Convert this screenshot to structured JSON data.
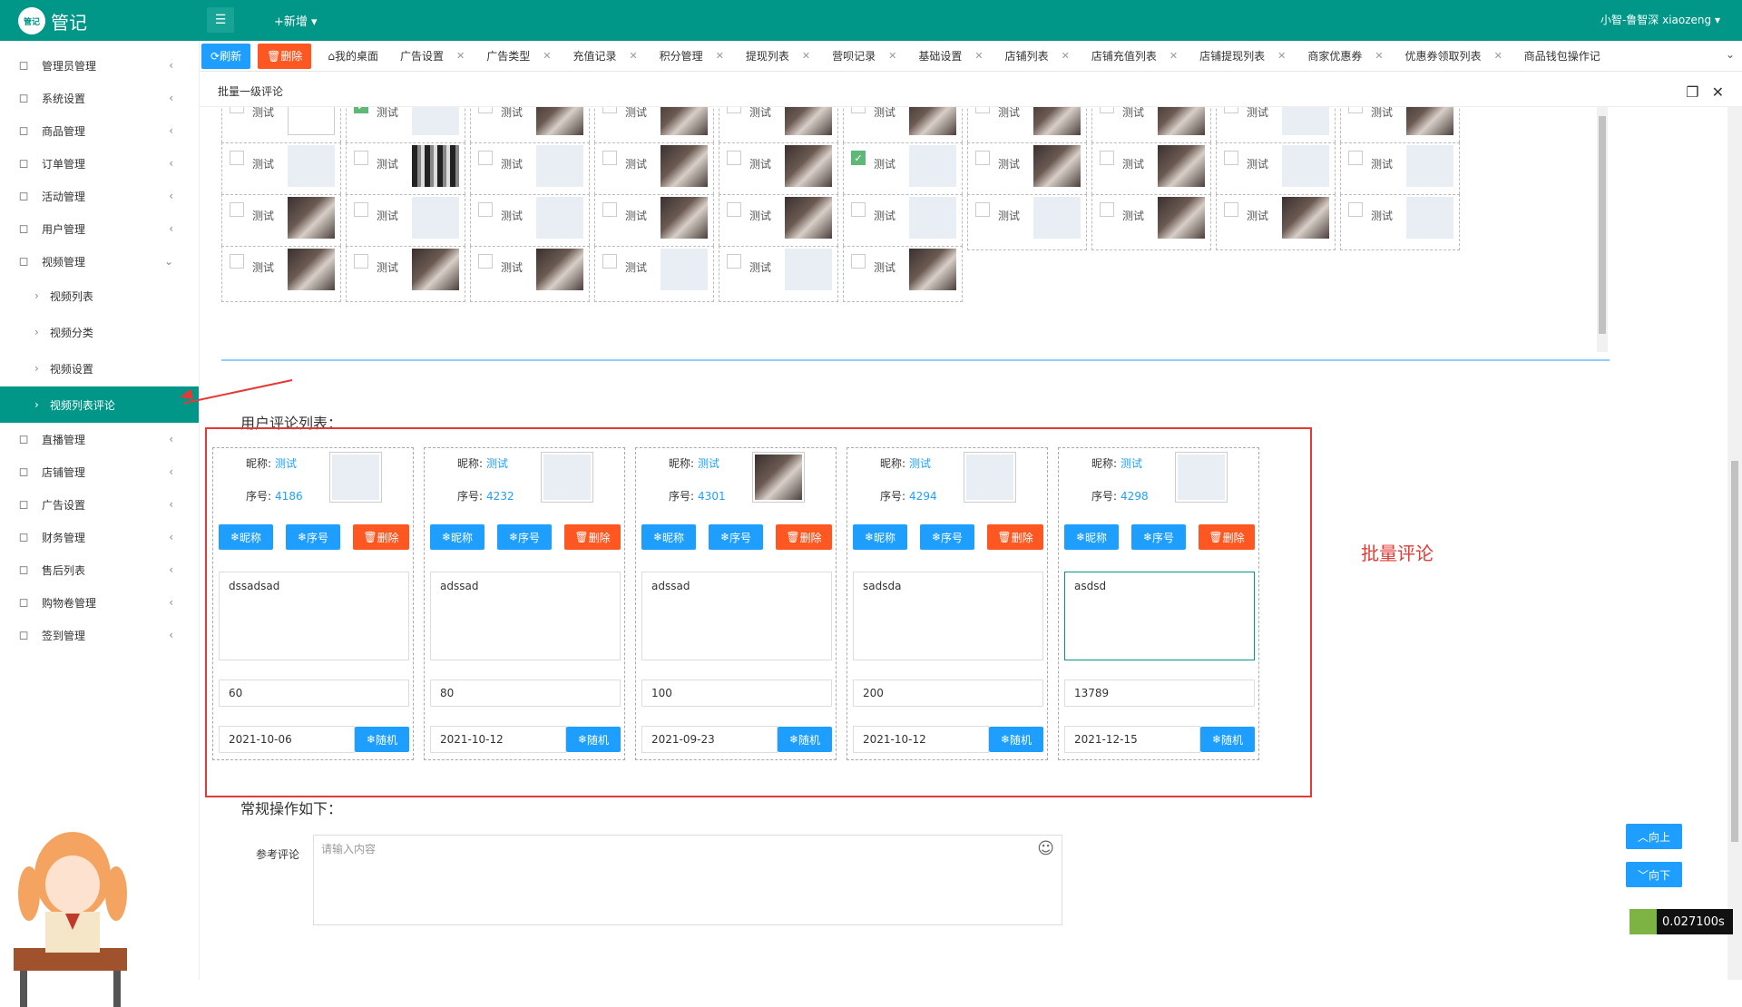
{
  "header": {
    "logo_text": "管记",
    "logo_badge": "管记",
    "new_label": "+新增",
    "user_label": "小智-鲁智深 xiaozeng"
  },
  "sidebar": {
    "items": [
      {
        "label": "管理员管理",
        "icon": "user-icon"
      },
      {
        "label": "系统设置",
        "icon": "gear-icon"
      },
      {
        "label": "商品管理",
        "icon": "bag-icon"
      },
      {
        "label": "订单管理",
        "icon": "order-icon"
      },
      {
        "label": "活动管理",
        "icon": "activity-icon"
      },
      {
        "label": "用户管理",
        "icon": "user-icon"
      },
      {
        "label": "视频管理",
        "icon": "video-icon"
      }
    ],
    "sub_items": [
      {
        "label": "视频列表"
      },
      {
        "label": "视频分类"
      },
      {
        "label": "视频设置"
      },
      {
        "label": "视频列表评论"
      }
    ],
    "items_after": [
      {
        "label": "直播管理",
        "icon": "live-icon"
      },
      {
        "label": "店铺管理",
        "icon": "shop-icon"
      },
      {
        "label": "广告设置",
        "icon": "image-icon"
      },
      {
        "label": "财务管理",
        "icon": "finance-icon"
      },
      {
        "label": "售后列表",
        "icon": "service-icon"
      },
      {
        "label": "购物卷管理",
        "icon": "coupon-icon"
      },
      {
        "label": "签到管理",
        "icon": "signin-icon"
      }
    ]
  },
  "tabbar": {
    "refresh_label": "刷新",
    "delete_label": "删除",
    "tabs": [
      "我的桌面",
      "广告设置",
      "广告类型",
      "充值记录",
      "积分管理",
      "提现列表",
      "营呗记录",
      "基础设置",
      "店铺列表",
      "店铺充值列表",
      "店铺提现列表",
      "商家优惠券",
      "优惠券领取列表",
      "商品钱包操作记"
    ]
  },
  "breadcrumb": {
    "title": "批量一级评论"
  },
  "grid": {
    "cell_label": "测试",
    "rows": [
      [
        [
          "blank",
          false
        ],
        [
          "ph",
          true
        ],
        [
          "photo",
          false
        ],
        [
          "photo",
          false
        ],
        [
          "photo",
          false
        ],
        [
          "photo",
          false
        ],
        [
          "photo",
          false
        ],
        [
          "photo",
          false
        ],
        [
          "ph",
          false
        ],
        [
          "photo",
          false
        ]
      ],
      [
        [
          "ph",
          false
        ],
        [
          "bw",
          false
        ],
        [
          "ph",
          false
        ],
        [
          "photo",
          false
        ],
        [
          "photo",
          false
        ],
        [
          "ph",
          true
        ],
        [
          "photo",
          false
        ],
        [
          "photo",
          false
        ],
        [
          "ph",
          false
        ],
        [
          "ph",
          false
        ]
      ],
      [
        [
          "photo",
          false
        ],
        [
          "ph",
          false
        ],
        [
          "ph",
          false
        ],
        [
          "photo",
          false
        ],
        [
          "photo",
          false
        ],
        [
          "ph",
          false
        ],
        [
          "ph",
          false
        ],
        [
          "photo",
          false
        ],
        [
          "photo",
          false
        ],
        [
          "ph",
          false
        ]
      ],
      [
        [
          "photo",
          false
        ],
        [
          "photo",
          false
        ],
        [
          "photo",
          false
        ],
        [
          "ph",
          false
        ],
        [
          "ph",
          false
        ],
        [
          "photo",
          false
        ]
      ]
    ]
  },
  "comments": {
    "section_title": "用户评论列表：",
    "nickname_label": "昵称:",
    "index_label": "序号:",
    "btn_nickname": "昵称",
    "btn_index": "序号",
    "btn_delete": "删除",
    "btn_random": "随机",
    "cards": [
      {
        "nickname": "测试",
        "index": "4186",
        "avatar": "ph",
        "text": "dssadsad",
        "count": "60",
        "date": "2021-10-06",
        "focus": false
      },
      {
        "nickname": "测试",
        "index": "4232",
        "avatar": "ph",
        "text": "adssad",
        "count": "80",
        "date": "2021-10-12",
        "focus": false
      },
      {
        "nickname": "测试",
        "index": "4301",
        "avatar": "photo",
        "text": "adssad",
        "count": "100",
        "date": "2021-09-23",
        "focus": false
      },
      {
        "nickname": "测试",
        "index": "4294",
        "avatar": "ph",
        "text": "sadsda",
        "count": "200",
        "date": "2021-10-12",
        "focus": false
      },
      {
        "nickname": "测试",
        "index": "4298",
        "avatar": "ph",
        "text": "asdsd",
        "count": "13789",
        "date": "2021-12-15",
        "focus": true
      }
    ],
    "annotation": "批量评论"
  },
  "operations": {
    "title": "常规操作如下：",
    "ref_label": "参考评论",
    "ref_placeholder": "请输入内容",
    "up_label": "向上",
    "down_label": "向下"
  },
  "timer": {
    "value": "0.027100s"
  },
  "colors": {
    "primary": "#009688",
    "blue": "#1e9fff",
    "red": "#ff5722",
    "annotation": "#e53935"
  }
}
